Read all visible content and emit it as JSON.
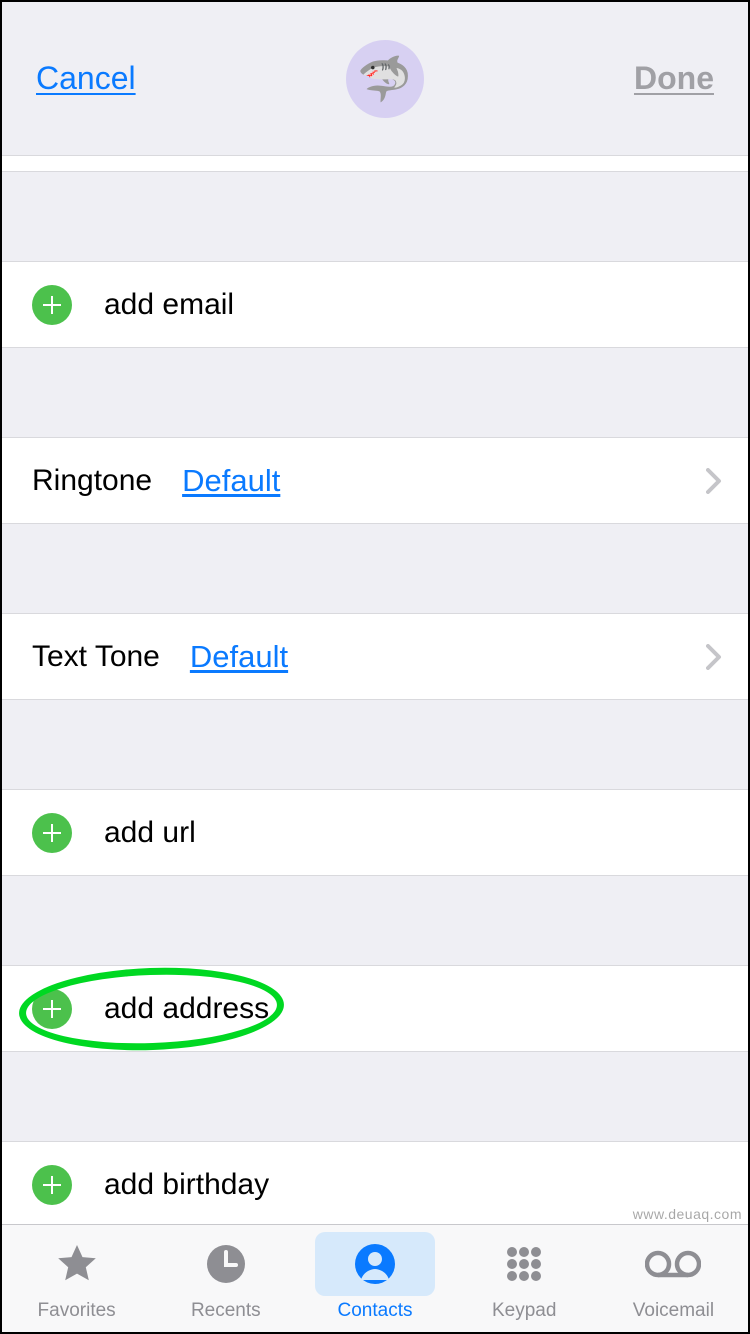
{
  "header": {
    "cancel": "Cancel",
    "done": "Done",
    "avatar_emoji": "🦈"
  },
  "rows": {
    "add_email": "add email",
    "ringtone_label": "Ringtone",
    "ringtone_value": "Default",
    "texttone_label": "Text Tone",
    "texttone_value": "Default",
    "add_url": "add url",
    "add_address": "add address",
    "add_birthday": "add birthday"
  },
  "tabs": {
    "favorites": "Favorites",
    "recents": "Recents",
    "contacts": "Contacts",
    "keypad": "Keypad",
    "voicemail": "Voicemail"
  },
  "watermark": "www.deuaq.com"
}
